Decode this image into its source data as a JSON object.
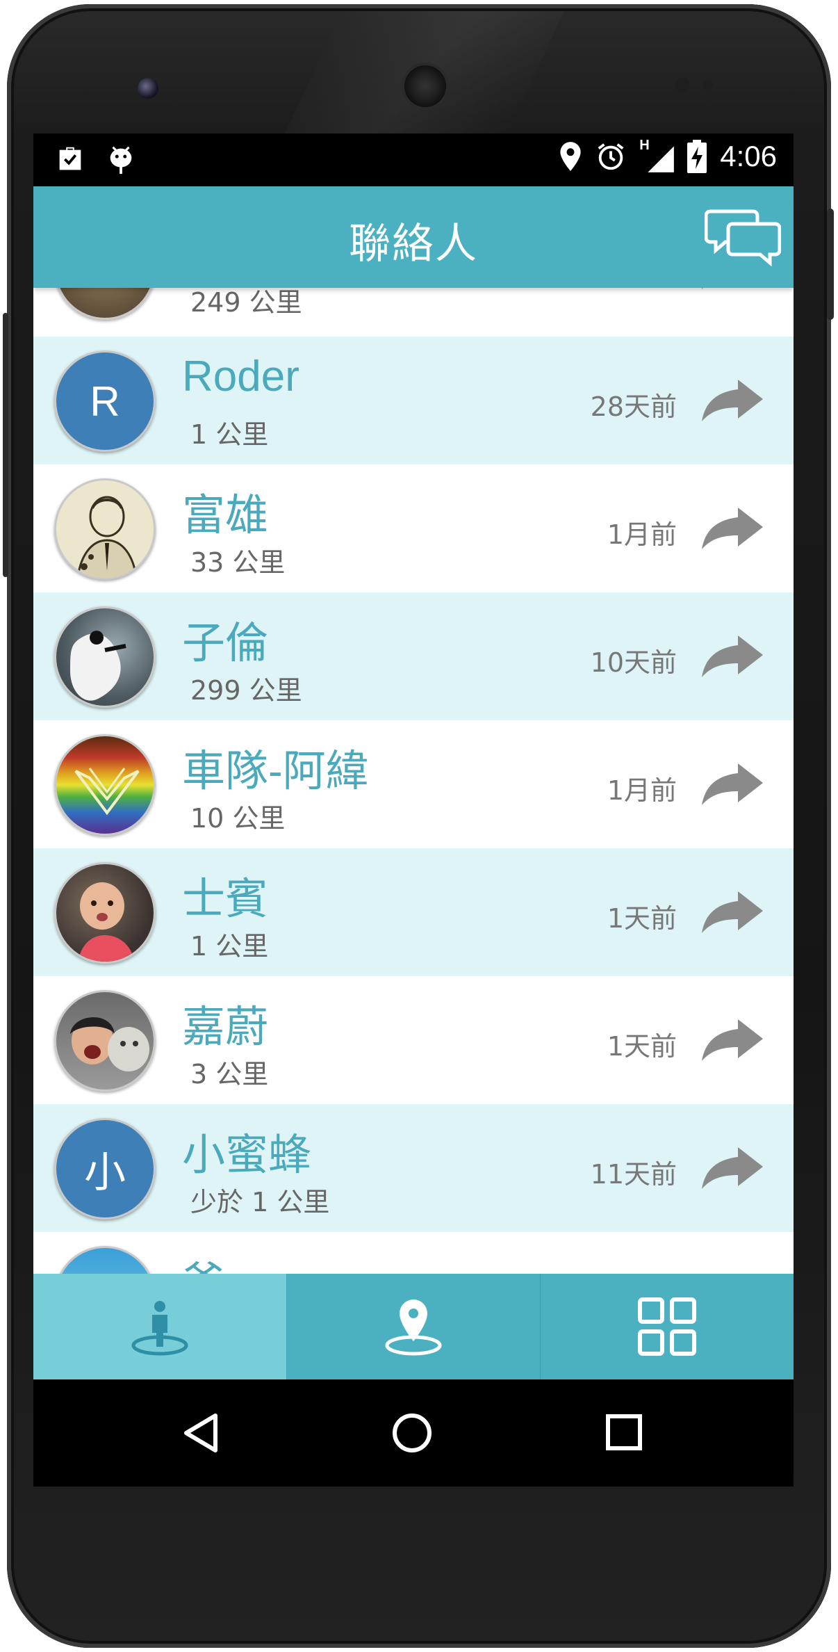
{
  "status_bar": {
    "time": "4:06",
    "network_label": "H",
    "left_icons": [
      "briefcase-check-icon",
      "android-debug-icon"
    ],
    "right_icons": [
      "location-pin-icon",
      "alarm-clock-icon",
      "signal-icon",
      "battery-charging-icon"
    ]
  },
  "app_bar": {
    "title": "聯絡人",
    "action_icon": "chat-bubbles-icon"
  },
  "contacts": [
    {
      "name": "",
      "distance": "249 公里",
      "ago": "",
      "avatar": "photo"
    },
    {
      "name": "Roder",
      "distance": "1 公里",
      "ago": "28天前",
      "avatar": "letter",
      "avatar_letter": "R"
    },
    {
      "name": "富雄",
      "distance": "33 公里",
      "ago": "1月前",
      "avatar": "photo"
    },
    {
      "name": "子倫",
      "distance": "299 公里",
      "ago": "10天前",
      "avatar": "photo"
    },
    {
      "name": "車隊-阿緯",
      "distance": "10 公里",
      "ago": "1月前",
      "avatar": "photo"
    },
    {
      "name": "士賓",
      "distance": "1 公里",
      "ago": "1天前",
      "avatar": "photo"
    },
    {
      "name": "嘉蔚",
      "distance": "3 公里",
      "ago": "1天前",
      "avatar": "photo"
    },
    {
      "name": "小蜜蜂",
      "distance": "少於 1 公里",
      "ago": "11天前",
      "avatar": "letter",
      "avatar_letter": "小"
    },
    {
      "name": "爸",
      "distance": "",
      "ago": "",
      "avatar": "photo"
    }
  ],
  "bottom_nav": [
    {
      "icon": "person-radar-icon",
      "active": true
    },
    {
      "icon": "map-pin-icon",
      "active": false
    },
    {
      "icon": "grid-apps-icon",
      "active": false
    }
  ],
  "system_nav": [
    "back-icon",
    "home-icon",
    "recents-icon"
  ],
  "colors": {
    "primary": "#4bb0c0",
    "active_tab": "#77cdd8",
    "row_alt": "#dff4f6",
    "name_text": "#4aa9bb",
    "avatar_letter_bg": "#3f7fb8"
  }
}
